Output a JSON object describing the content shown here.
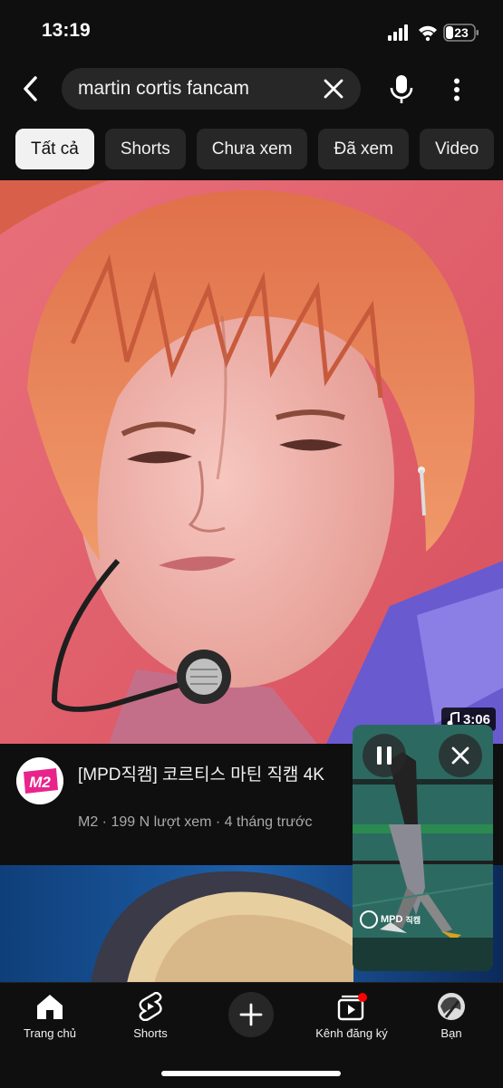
{
  "status_bar": {
    "time": "13:19",
    "battery": "23"
  },
  "search": {
    "query": "martin cortis fancam"
  },
  "chips": [
    {
      "label": "Tất cả",
      "active": true
    },
    {
      "label": "Shorts",
      "active": false
    },
    {
      "label": "Chưa xem",
      "active": false
    },
    {
      "label": "Đã xem",
      "active": false
    },
    {
      "label": "Video",
      "active": false
    }
  ],
  "video": {
    "duration": "3:06",
    "title": "[MPD직캠] 코르티스 마틴 직캠 4K",
    "meta": "M2 · 199 N lượt xem · 4 tháng trước",
    "channel_logo_text": "M2"
  },
  "mini_player": {
    "logo_text": "MPD",
    "logo_sub": "직캠"
  },
  "bottom_nav": [
    {
      "label": "Trang chủ",
      "icon": "home-icon"
    },
    {
      "label": "Shorts",
      "icon": "shorts-icon"
    },
    {
      "label": "",
      "icon": "create-icon"
    },
    {
      "label": "Kênh đăng ký",
      "icon": "subscriptions-icon"
    },
    {
      "label": "Bạn",
      "icon": "avatar"
    }
  ],
  "colors": {
    "background": "#0f0f0f",
    "chip": "#272727",
    "chip_active": "#f1f1f1",
    "accent_red": "#ff0000"
  }
}
